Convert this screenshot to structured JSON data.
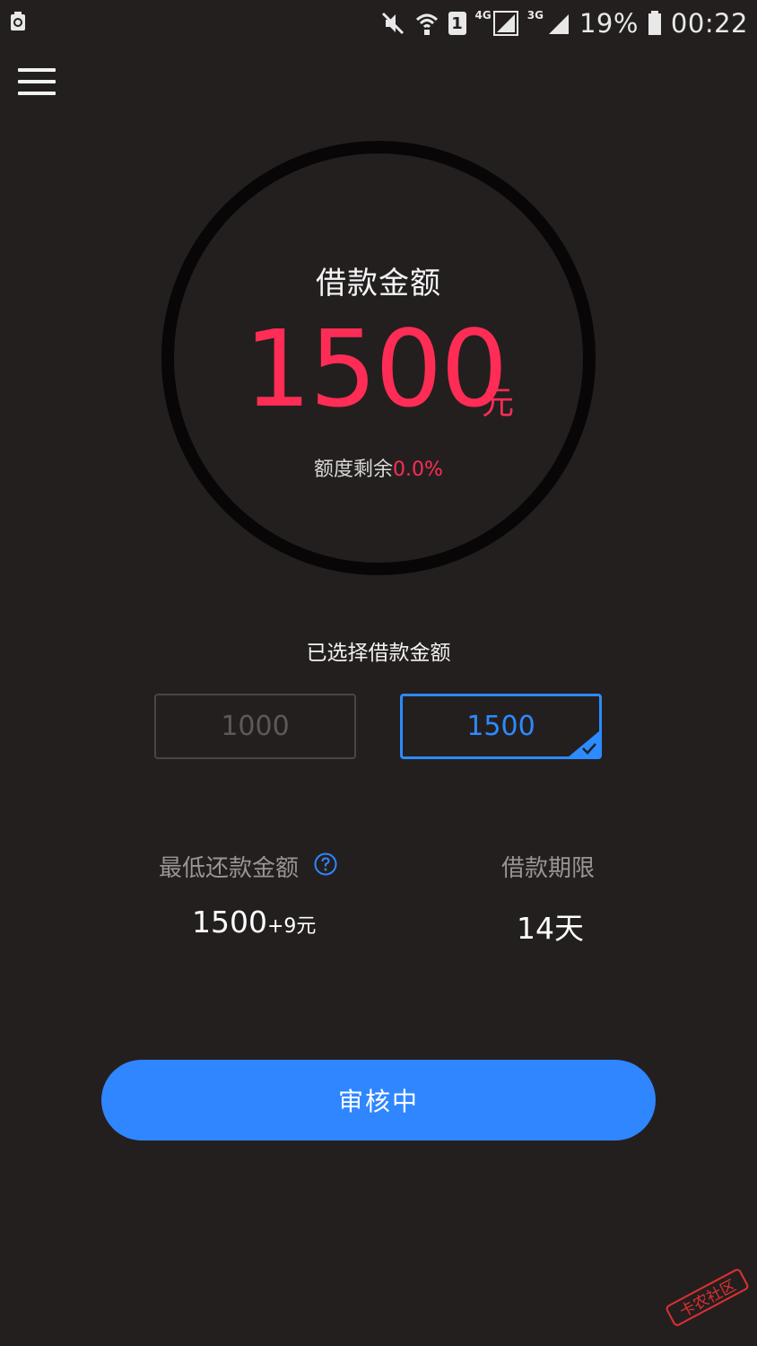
{
  "status_bar": {
    "network_4g": "4G",
    "network_3g": "3G",
    "sim_slot": "1",
    "battery": "19%",
    "time": "00:22"
  },
  "loan": {
    "title": "借款金额",
    "amount": "1500",
    "unit": "元",
    "remaining_label": "额度剩余",
    "remaining_value": "0.0%"
  },
  "selection": {
    "label": "已选择借款金额",
    "options": [
      "1000",
      "1500"
    ],
    "selected": "1500"
  },
  "repayment": {
    "min_label": "最低还款金额",
    "min_amount": "1500",
    "min_fee": "+9元",
    "term_label": "借款期限",
    "term_value": "14天"
  },
  "submit_label": "审核中",
  "watermark_text": "卡农社区",
  "colors": {
    "background": "#241f1f",
    "accent_red": "#ff2d55",
    "accent_blue": "#2f86ff"
  }
}
